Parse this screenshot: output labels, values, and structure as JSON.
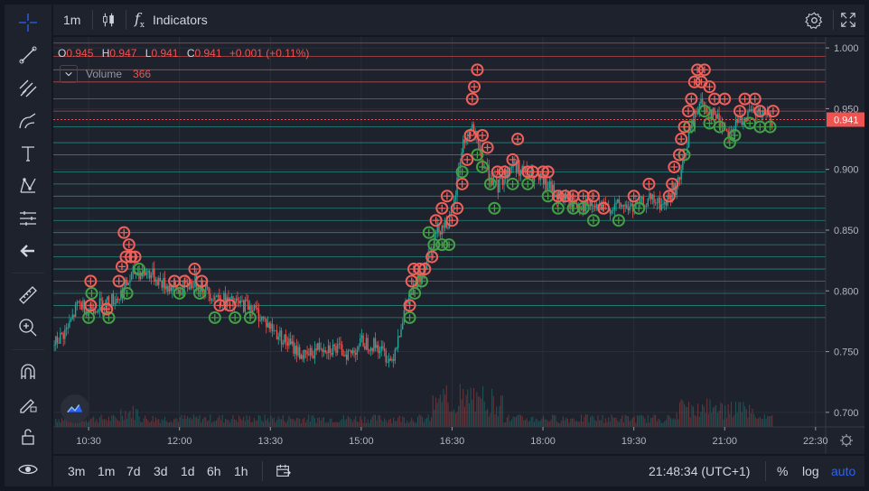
{
  "top_bar": {
    "interval_label": "1m",
    "indicators_label": "Indicators"
  },
  "legend": {
    "open_label": "O",
    "open_value": "0.945",
    "high_label": "H",
    "high_value": "0.947",
    "low_label": "L",
    "low_value": "0.941",
    "close_label": "C",
    "close_value": "0.941",
    "change": "+0.001 (+0.11%)",
    "volume_label": "Volume",
    "volume_value": "366"
  },
  "price_axis": {
    "labels": [
      "1.000",
      "0.950",
      "0.900",
      "0.850",
      "0.800",
      "0.750",
      "0.700"
    ],
    "current_price_label": "0.941"
  },
  "time_axis": {
    "labels": [
      "10:30",
      "12:00",
      "13:30",
      "15:00",
      "16:30",
      "18:00",
      "19:30",
      "21:00",
      "22:30"
    ]
  },
  "bottom_bar": {
    "ranges": [
      "3m",
      "1m",
      "7d",
      "3d",
      "1d",
      "6h",
      "1h"
    ],
    "time_readout": "21:48:34 (UTC+1)",
    "percent_label": "%",
    "log_label": "log",
    "auto_label": "auto"
  },
  "colors": {
    "up": "#26a69a",
    "down": "#ef5350",
    "marker_up": "#43a047",
    "marker_down": "#f0605a",
    "accent": "#2962ff",
    "background": "#1e222d"
  },
  "chart_data": {
    "type": "candlestick",
    "y_range": [
      0.688,
      1.009
    ],
    "x_range": [
      "09:55",
      "22:40"
    ],
    "price_path": [
      [
        "09:55",
        0.755
      ],
      [
        "10:10",
        0.77
      ],
      [
        "10:20",
        0.79
      ],
      [
        "10:30",
        0.785
      ],
      [
        "10:45",
        0.79
      ],
      [
        "11:00",
        0.795
      ],
      [
        "11:15",
        0.815
      ],
      [
        "11:30",
        0.815
      ],
      [
        "11:45",
        0.805
      ],
      [
        "12:00",
        0.8
      ],
      [
        "12:15",
        0.808
      ],
      [
        "12:30",
        0.798
      ],
      [
        "12:50",
        0.79
      ],
      [
        "13:10",
        0.788
      ],
      [
        "13:30",
        0.77
      ],
      [
        "13:50",
        0.755
      ],
      [
        "14:05",
        0.745
      ],
      [
        "14:20",
        0.755
      ],
      [
        "14:35",
        0.752
      ],
      [
        "14:50",
        0.748
      ],
      [
        "15:00",
        0.758
      ],
      [
        "15:15",
        0.755
      ],
      [
        "15:30",
        0.742
      ],
      [
        "15:45",
        0.79
      ],
      [
        "16:00",
        0.815
      ],
      [
        "16:15",
        0.85
      ],
      [
        "16:30",
        0.86
      ],
      [
        "16:40",
        0.92
      ],
      [
        "16:50",
        0.935
      ],
      [
        "17:00",
        0.905
      ],
      [
        "17:15",
        0.885
      ],
      [
        "17:30",
        0.905
      ],
      [
        "17:45",
        0.895
      ],
      [
        "18:00",
        0.89
      ],
      [
        "18:15",
        0.878
      ],
      [
        "18:30",
        0.872
      ],
      [
        "18:45",
        0.87
      ],
      [
        "19:00",
        0.868
      ],
      [
        "19:15",
        0.87
      ],
      [
        "19:30",
        0.868
      ],
      [
        "19:45",
        0.875
      ],
      [
        "20:00",
        0.87
      ],
      [
        "20:15",
        0.89
      ],
      [
        "20:25",
        0.93
      ],
      [
        "20:35",
        0.955
      ],
      [
        "20:50",
        0.945
      ],
      [
        "21:05",
        0.93
      ],
      [
        "21:20",
        0.945
      ],
      [
        "21:35",
        0.945
      ],
      [
        "21:48",
        0.941
      ]
    ],
    "markers_down": [
      [
        "10:32",
        0.808
      ],
      [
        "10:32",
        0.788
      ],
      [
        "10:48",
        0.785
      ],
      [
        "11:00",
        0.808
      ],
      [
        "11:03",
        0.82
      ],
      [
        "11:05",
        0.848
      ],
      [
        "11:07",
        0.828
      ],
      [
        "11:10",
        0.838
      ],
      [
        "11:12",
        0.828
      ],
      [
        "11:16",
        0.828
      ],
      [
        "11:55",
        0.808
      ],
      [
        "12:05",
        0.808
      ],
      [
        "12:15",
        0.818
      ],
      [
        "12:22",
        0.808
      ],
      [
        "12:40",
        0.788
      ],
      [
        "12:50",
        0.788
      ],
      [
        "15:48",
        0.788
      ],
      [
        "15:50",
        0.808
      ],
      [
        "15:52",
        0.818
      ],
      [
        "15:58",
        0.818
      ],
      [
        "16:03",
        0.818
      ],
      [
        "16:10",
        0.828
      ],
      [
        "16:14",
        0.858
      ],
      [
        "16:20",
        0.868
      ],
      [
        "16:25",
        0.878
      ],
      [
        "16:30",
        0.858
      ],
      [
        "16:35",
        0.868
      ],
      [
        "16:40",
        0.888
      ],
      [
        "16:45",
        0.908
      ],
      [
        "16:48",
        0.928
      ],
      [
        "16:50",
        0.958
      ],
      [
        "16:52",
        0.968
      ],
      [
        "16:55",
        0.982
      ],
      [
        "17:00",
        0.928
      ],
      [
        "17:05",
        0.918
      ],
      [
        "17:15",
        0.898
      ],
      [
        "17:22",
        0.898
      ],
      [
        "17:30",
        0.908
      ],
      [
        "17:35",
        0.925
      ],
      [
        "17:45",
        0.898
      ],
      [
        "17:50",
        0.898
      ],
      [
        "18:00",
        0.898
      ],
      [
        "18:05",
        0.898
      ],
      [
        "18:15",
        0.878
      ],
      [
        "18:22",
        0.878
      ],
      [
        "18:30",
        0.878
      ],
      [
        "18:40",
        0.878
      ],
      [
        "18:50",
        0.878
      ],
      [
        "19:00",
        0.868
      ],
      [
        "19:30",
        0.878
      ],
      [
        "19:45",
        0.888
      ],
      [
        "20:05",
        0.878
      ],
      [
        "20:08",
        0.888
      ],
      [
        "20:10",
        0.902
      ],
      [
        "20:15",
        0.912
      ],
      [
        "20:17",
        0.925
      ],
      [
        "20:20",
        0.935
      ],
      [
        "20:24",
        0.948
      ],
      [
        "20:27",
        0.958
      ],
      [
        "20:30",
        0.972
      ],
      [
        "20:33",
        0.982
      ],
      [
        "20:37",
        0.972
      ],
      [
        "20:40",
        0.982
      ],
      [
        "20:45",
        0.968
      ],
      [
        "20:50",
        0.958
      ],
      [
        "21:00",
        0.958
      ],
      [
        "21:15",
        0.948
      ],
      [
        "21:20",
        0.958
      ],
      [
        "21:30",
        0.958
      ],
      [
        "21:35",
        0.948
      ],
      [
        "21:48",
        0.948
      ]
    ],
    "markers_up": [
      [
        "10:30",
        0.778
      ],
      [
        "10:33",
        0.798
      ],
      [
        "10:50",
        0.778
      ],
      [
        "11:08",
        0.798
      ],
      [
        "11:20",
        0.818
      ],
      [
        "12:00",
        0.798
      ],
      [
        "12:20",
        0.798
      ],
      [
        "12:35",
        0.778
      ],
      [
        "12:55",
        0.778
      ],
      [
        "13:10",
        0.778
      ],
      [
        "15:48",
        0.778
      ],
      [
        "15:53",
        0.798
      ],
      [
        "16:00",
        0.808
      ],
      [
        "16:07",
        0.848
      ],
      [
        "16:12",
        0.838
      ],
      [
        "16:20",
        0.838
      ],
      [
        "16:27",
        0.838
      ],
      [
        "16:40",
        0.898
      ],
      [
        "16:55",
        0.912
      ],
      [
        "17:00",
        0.902
      ],
      [
        "17:08",
        0.888
      ],
      [
        "17:12",
        0.868
      ],
      [
        "17:30",
        0.888
      ],
      [
        "17:45",
        0.888
      ],
      [
        "18:05",
        0.878
      ],
      [
        "18:15",
        0.868
      ],
      [
        "18:30",
        0.868
      ],
      [
        "18:40",
        0.868
      ],
      [
        "18:50",
        0.858
      ],
      [
        "19:15",
        0.858
      ],
      [
        "19:35",
        0.868
      ],
      [
        "20:20",
        0.912
      ],
      [
        "20:25",
        0.935
      ],
      [
        "20:40",
        0.948
      ],
      [
        "20:45",
        0.938
      ],
      [
        "20:55",
        0.935
      ],
      [
        "21:05",
        0.922
      ],
      [
        "21:10",
        0.928
      ],
      [
        "21:25",
        0.938
      ],
      [
        "21:35",
        0.935
      ],
      [
        "21:45",
        0.935
      ]
    ],
    "horizontal_levels_up": [
      0.778,
      0.788,
      0.798,
      0.808,
      0.818,
      0.828,
      0.838,
      0.848,
      0.858,
      0.868,
      0.878,
      0.888,
      0.898,
      0.912,
      0.922,
      0.935
    ],
    "horizontal_levels_down": [
      0.948,
      0.958,
      0.972,
      0.982,
      0.993,
      1.004
    ],
    "grid": true
  }
}
